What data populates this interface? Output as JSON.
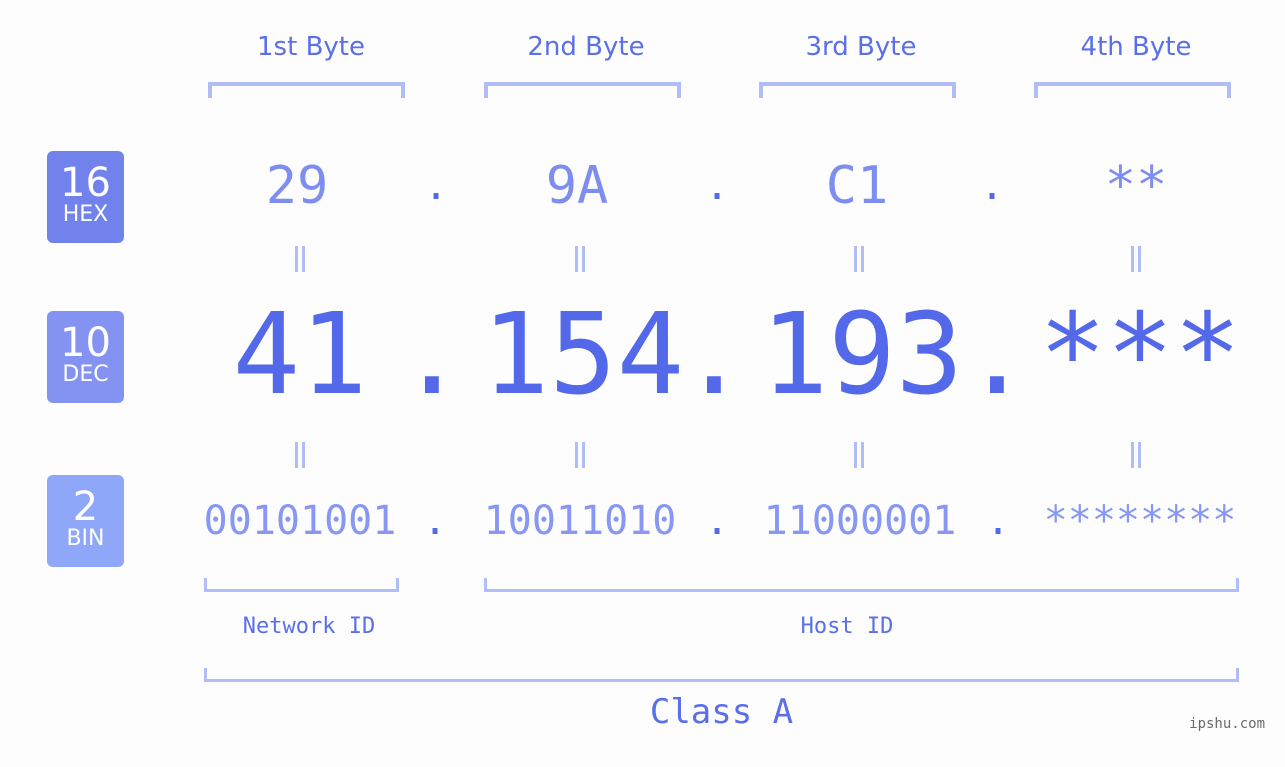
{
  "bytes_headers": [
    "1st Byte",
    "2nd Byte",
    "3rd Byte",
    "4th Byte"
  ],
  "badges": {
    "hex": {
      "num": "16",
      "label": "HEX",
      "color": "#7282ec"
    },
    "dec": {
      "num": "10",
      "label": "DEC",
      "color": "#8493f1"
    },
    "bin": {
      "num": "2",
      "label": "BIN",
      "color": "#8fa7f8"
    }
  },
  "hex_values": [
    "29",
    "9A",
    "C1",
    "**"
  ],
  "dec_values": [
    "41",
    "154",
    "193",
    "***"
  ],
  "bin_values": [
    "00101001",
    "10011010",
    "11000001",
    "********"
  ],
  "separator": ".",
  "equals": "=",
  "network_id_label": "Network ID",
  "host_id_label": "Host ID",
  "class_label": "Class A",
  "watermark": "ipshu.com"
}
